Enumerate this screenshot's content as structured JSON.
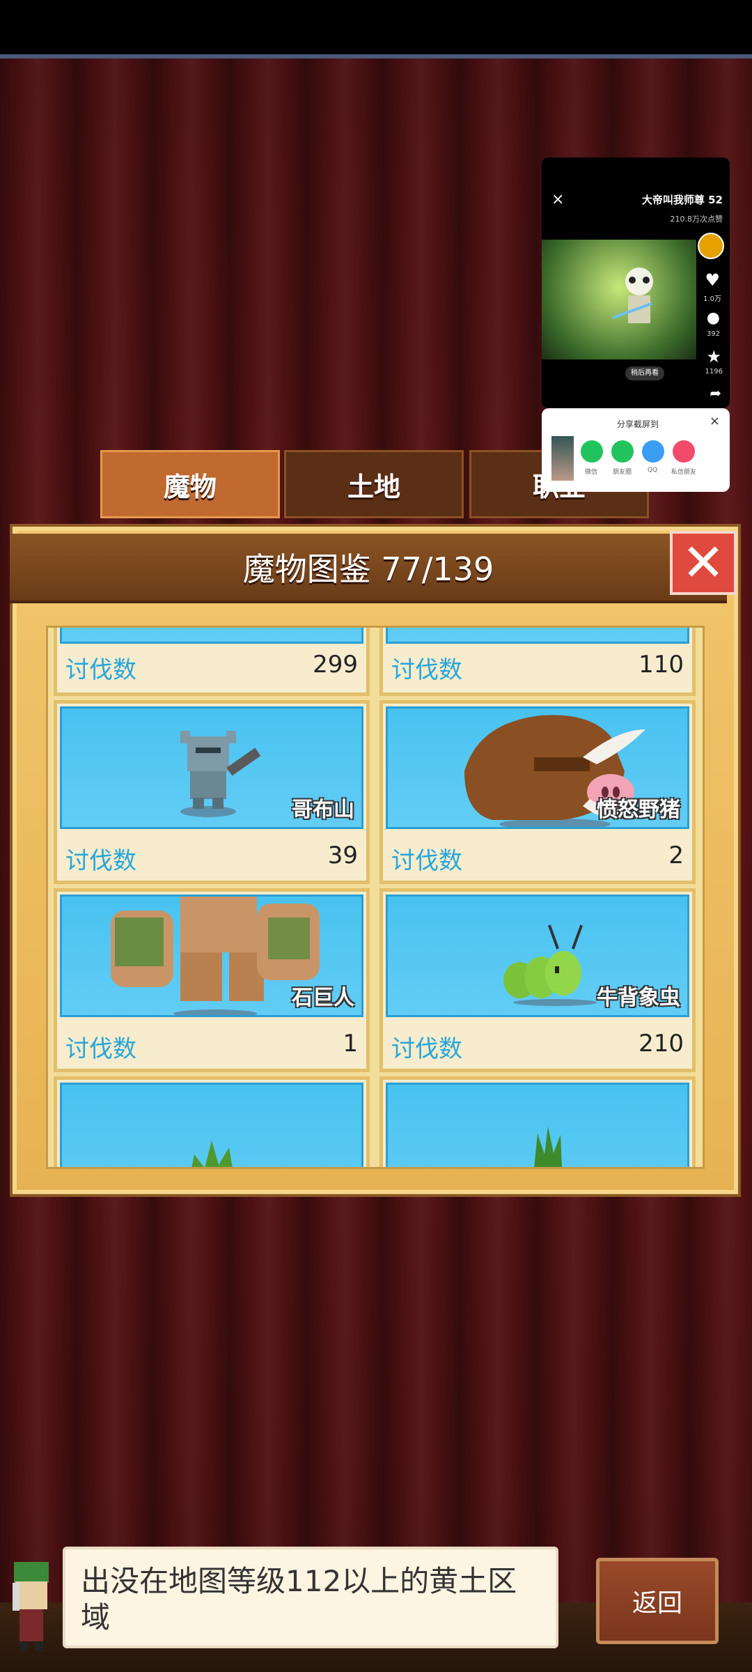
{
  "tabs": [
    {
      "label": "魔物"
    },
    {
      "label": "土地"
    },
    {
      "label": "职业"
    }
  ],
  "panel": {
    "title": "魔物图鉴 77/139",
    "close_symbol": "✕"
  },
  "stat_label": "讨伐数",
  "cards": [
    {
      "name": "",
      "kills": "299"
    },
    {
      "name": "",
      "kills": "110"
    },
    {
      "name": "哥布山",
      "kills": "39"
    },
    {
      "name": "愤怒野猪",
      "kills": "2"
    },
    {
      "name": "石巨人",
      "kills": "1"
    },
    {
      "name": "牛背象虫",
      "kills": "210"
    }
  ],
  "video_popup": {
    "title": "大帝叫我师尊 52",
    "views": "210.8万次点赞",
    "close_symbol": "×",
    "likes": "1.0万",
    "comments": "392",
    "stars": "1196",
    "replay_label": "稍后再看"
  },
  "share_sheet": {
    "title": "分享截屏到",
    "close_symbol": "×",
    "items": [
      {
        "label": "微信",
        "color": "#22c35d",
        "icon": "wechat-icon"
      },
      {
        "label": "朋友圈",
        "color": "#22c35d",
        "icon": "moments-icon"
      },
      {
        "label": "QQ",
        "color": "#3a9cf2",
        "icon": "qq-icon"
      },
      {
        "label": "私信朋友",
        "color": "#f24a6b",
        "icon": "send-icon"
      }
    ]
  },
  "hint": {
    "text": "出没在地图等级112以上的黄土区域"
  },
  "back_button": {
    "label": "返回"
  }
}
